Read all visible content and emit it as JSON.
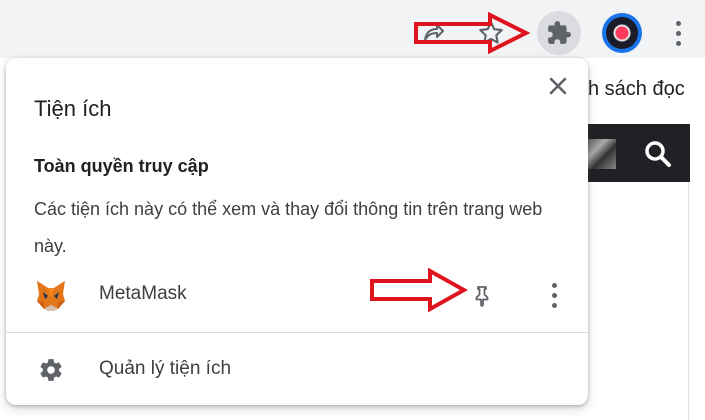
{
  "background_page": {
    "bookmarks_text": "h sách đọc"
  },
  "popup": {
    "title": "Tiện ích",
    "close_label": "✕",
    "section_heading": "Toàn quyền truy cập",
    "section_description": "Các tiện ích này có thể xem và thay đổi thông tin trên trang web này.",
    "extensions": [
      {
        "name": "MetaMask",
        "icon": "metamask-fox-icon",
        "pinned": false
      }
    ],
    "manage_label": "Quản lý tiện ích"
  },
  "colors": {
    "annotation_red": "#e0141e",
    "toolbar_bg": "#f1f3f4",
    "icon_gray": "#5f6368"
  }
}
